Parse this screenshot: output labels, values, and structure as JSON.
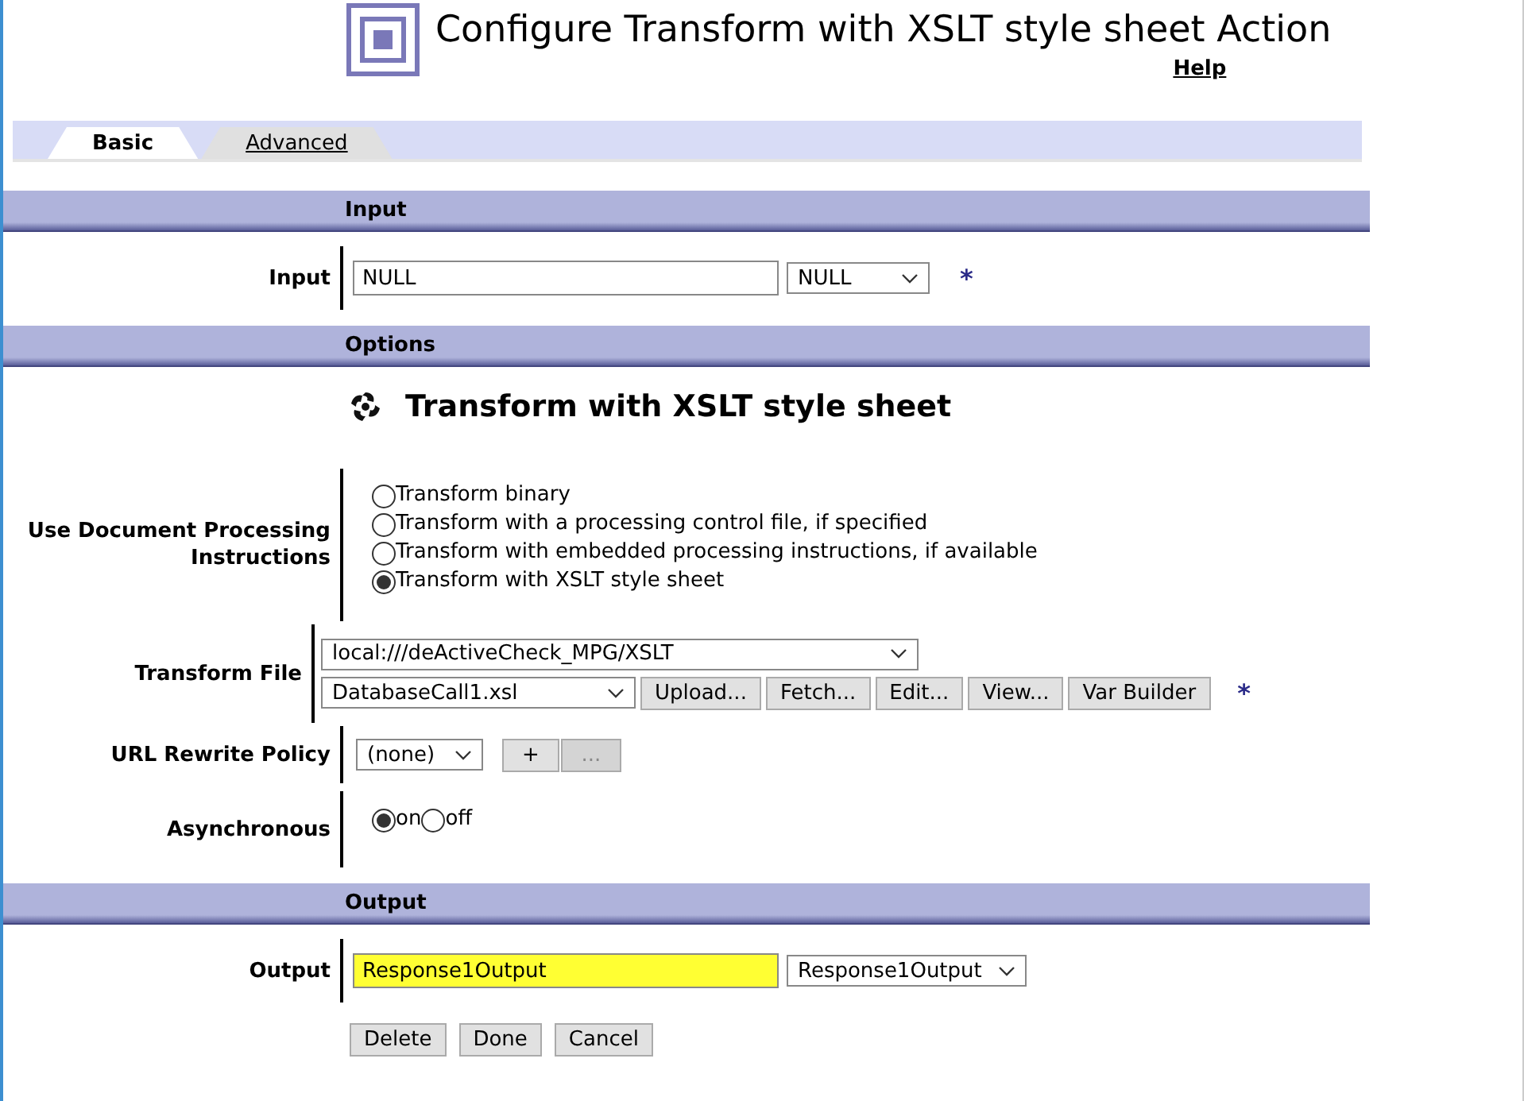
{
  "header": {
    "title": "Configure Transform with XSLT style sheet Action",
    "help": "Help"
  },
  "tabs": [
    {
      "label": "Basic",
      "selected": true
    },
    {
      "label": "Advanced",
      "selected": false
    }
  ],
  "sections": [
    {
      "title": "Input",
      "rows": [
        {
          "kind": "field",
          "label": "Input",
          "value": "NULL",
          "select": "NULL",
          "required": "*",
          "highlighted": false
        }
      ]
    },
    {
      "title": "Options",
      "heading": "Transform with XSLT style sheet",
      "rows": [
        {
          "kind": "radios",
          "label": "Use Document Processing Instructions",
          "options": [
            {
              "label": "Transform binary",
              "selected": false
            },
            {
              "label": "Transform with a processing control file, if specified",
              "selected": false
            },
            {
              "label": "Transform with embedded processing instructions, if available",
              "selected": false
            },
            {
              "label": "Transform with XSLT style sheet",
              "selected": true
            }
          ]
        },
        {
          "kind": "file",
          "label": "Transform File",
          "path": "local:///deActiveCheck_MPG/XSLT",
          "file": "DatabaseCall1.xsl",
          "buttons": [
            {
              "label": "Upload...",
              "disabled": false
            },
            {
              "label": "Fetch...",
              "disabled": false
            },
            {
              "label": "Edit...",
              "disabled": false
            },
            {
              "label": "View...",
              "disabled": false
            },
            {
              "label": "Var Builder",
              "disabled": false
            }
          ],
          "required": "*"
        },
        {
          "kind": "policy",
          "label": "URL Rewrite Policy",
          "select": "(none)",
          "buttons": [
            {
              "label": "+",
              "disabled": false
            },
            {
              "label": "...",
              "disabled": true
            }
          ]
        },
        {
          "kind": "radio-line",
          "label": "Asynchronous",
          "options": [
            {
              "label": "on",
              "selected": true
            },
            {
              "label": "off",
              "selected": false
            }
          ]
        }
      ]
    },
    {
      "title": "Output",
      "rows": [
        {
          "kind": "field",
          "label": "Output",
          "value": "Response1Output",
          "select": "Response1Output",
          "required": "",
          "highlighted": true
        }
      ]
    }
  ],
  "buttons": [
    "Delete",
    "Done",
    "Cancel"
  ]
}
